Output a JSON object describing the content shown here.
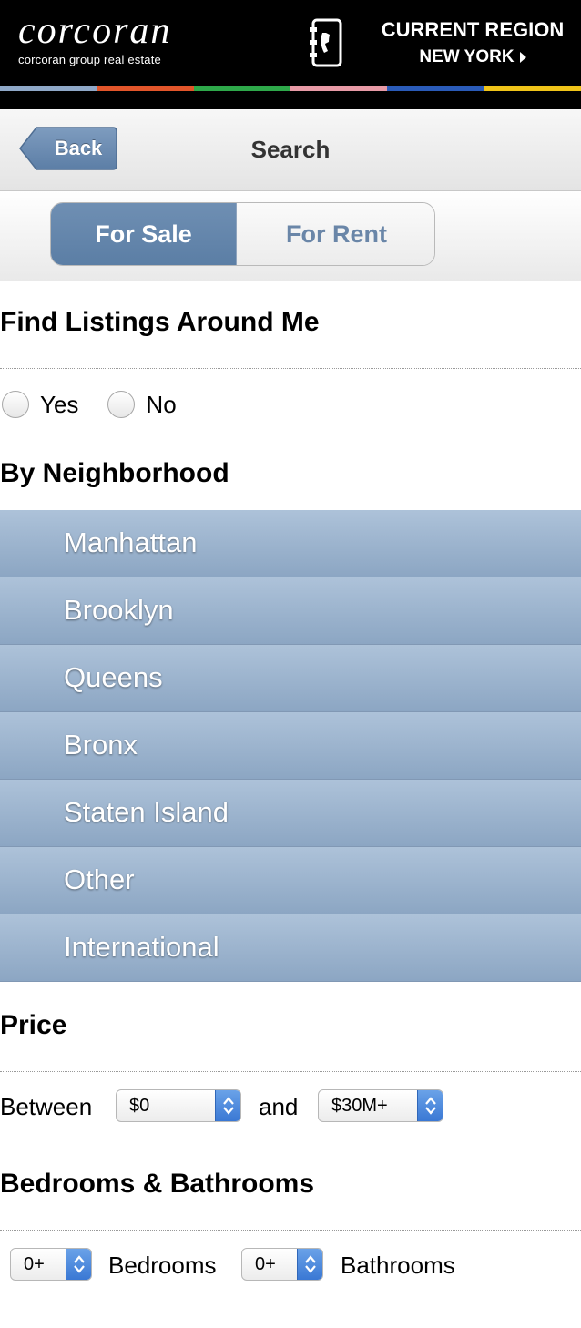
{
  "header": {
    "logo_word": "corcoran",
    "logo_tagline": "corcoran group real estate",
    "region_title": "CURRENT REGION",
    "region_name": "NEW YORK",
    "phone_icon": "phone-book-icon",
    "strip_colors": [
      "#8fa8c8",
      "#e2552a",
      "#2ea84a",
      "#e79aa6",
      "#2a5bb8",
      "#f0c419"
    ]
  },
  "navbar": {
    "back_label": "Back",
    "title": "Search"
  },
  "segmented": {
    "options": [
      "For Sale",
      "For Rent"
    ],
    "selected": "For Sale"
  },
  "around_me": {
    "title": "Find Listings Around Me",
    "options": [
      "Yes",
      "No"
    ]
  },
  "neighborhood": {
    "title": "By Neighborhood",
    "items": [
      "Manhattan",
      "Brooklyn",
      "Queens",
      "Bronx",
      "Staten Island",
      "Other",
      "International"
    ]
  },
  "price": {
    "title": "Price",
    "between_label": "Between",
    "and_label": "and",
    "min_value": "$0",
    "max_value": "$30M+"
  },
  "rooms": {
    "title": "Bedrooms & Bathrooms",
    "bedrooms_value": "0+",
    "bedrooms_label": "Bedrooms",
    "bathrooms_value": "0+",
    "bathrooms_label": "Bathrooms"
  },
  "colors": {
    "accent": "#5b7ea5",
    "list_bg": "#9fb6cf",
    "select_arrow": "#3a78d4"
  }
}
